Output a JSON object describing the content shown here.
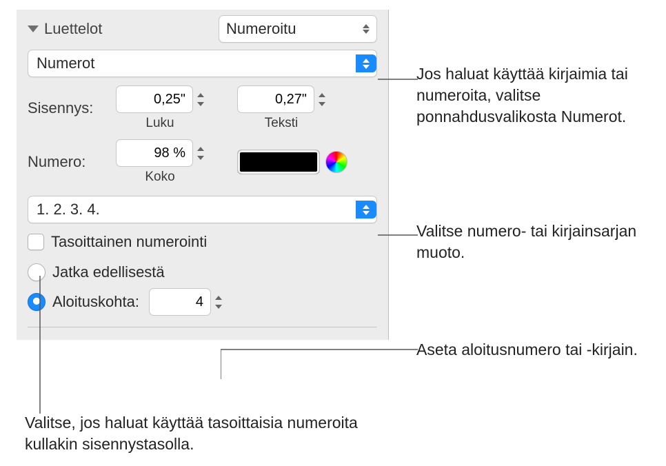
{
  "section": {
    "title": "Luettelot"
  },
  "list_type": {
    "selected": "Numeroitu"
  },
  "number_style_popup": {
    "selected": "Numerot"
  },
  "indent": {
    "label": "Sisennys:",
    "number_value": "0,25\"",
    "number_sublabel": "Luku",
    "text_value": "0,27\"",
    "text_sublabel": "Teksti"
  },
  "number": {
    "label": "Numero:",
    "size_value": "98 %",
    "size_sublabel": "Koko",
    "color": "#000000"
  },
  "sequence_format": {
    "selected": "1. 2. 3. 4."
  },
  "tiered": {
    "label": "Tasoittainen numerointi",
    "checked": false
  },
  "continue": {
    "label": "Jatka edellisestä",
    "selected": false
  },
  "start_at": {
    "label": "Aloituskohta:",
    "selected": true,
    "value": "4"
  },
  "callouts": {
    "c1": "Jos haluat käyttää kirjaimia tai numeroita, valitse ponnahdusvalikosta Numerot.",
    "c2": "Valitse numero- tai kirjainsarjan muoto.",
    "c3": "Aseta aloitusnumero tai -kirjain.",
    "c4": "Valitse, jos haluat käyttää tasoittaisia numeroita kullakin sisennystasolla."
  }
}
